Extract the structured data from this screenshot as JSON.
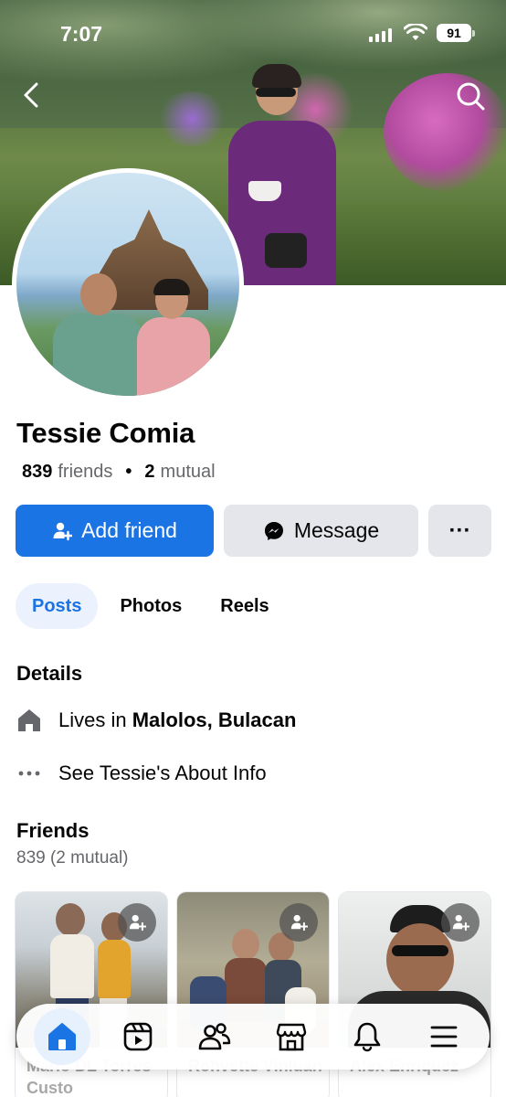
{
  "status_bar": {
    "time": "7:07",
    "battery": "91"
  },
  "profile": {
    "name": "Tessie Comia",
    "friends_count": "839",
    "friends_label": "friends",
    "mutual_count": "2",
    "mutual_label": "mutual"
  },
  "actions": {
    "add_friend": "Add friend",
    "message": "Message",
    "more": "···"
  },
  "tabs": [
    {
      "label": "Posts",
      "active": true
    },
    {
      "label": "Photos",
      "active": false
    },
    {
      "label": "Reels",
      "active": false
    }
  ],
  "details": {
    "title": "Details",
    "lives_prefix": "Lives in",
    "lives_place": "Malolos, Bulacan",
    "about_link": "See Tessie's About Info"
  },
  "friends": {
    "title": "Friends",
    "summary": "839 (2 mutual)",
    "cards": [
      {
        "name": "Mario DL Torres Custo"
      },
      {
        "name": "Rohvette Vinluan"
      },
      {
        "name": "Alex Enriquez"
      }
    ]
  },
  "bottom_nav": [
    {
      "icon": "home-icon",
      "active": true
    },
    {
      "icon": "reels-icon",
      "active": false
    },
    {
      "icon": "friends-icon",
      "active": false
    },
    {
      "icon": "marketplace-icon",
      "active": false
    },
    {
      "icon": "notifications-icon",
      "active": false
    },
    {
      "icon": "menu-icon",
      "active": false
    }
  ],
  "colors": {
    "accent": "#1b74e4",
    "button_gray": "#e4e6eb",
    "secondary_text": "#65676b"
  }
}
